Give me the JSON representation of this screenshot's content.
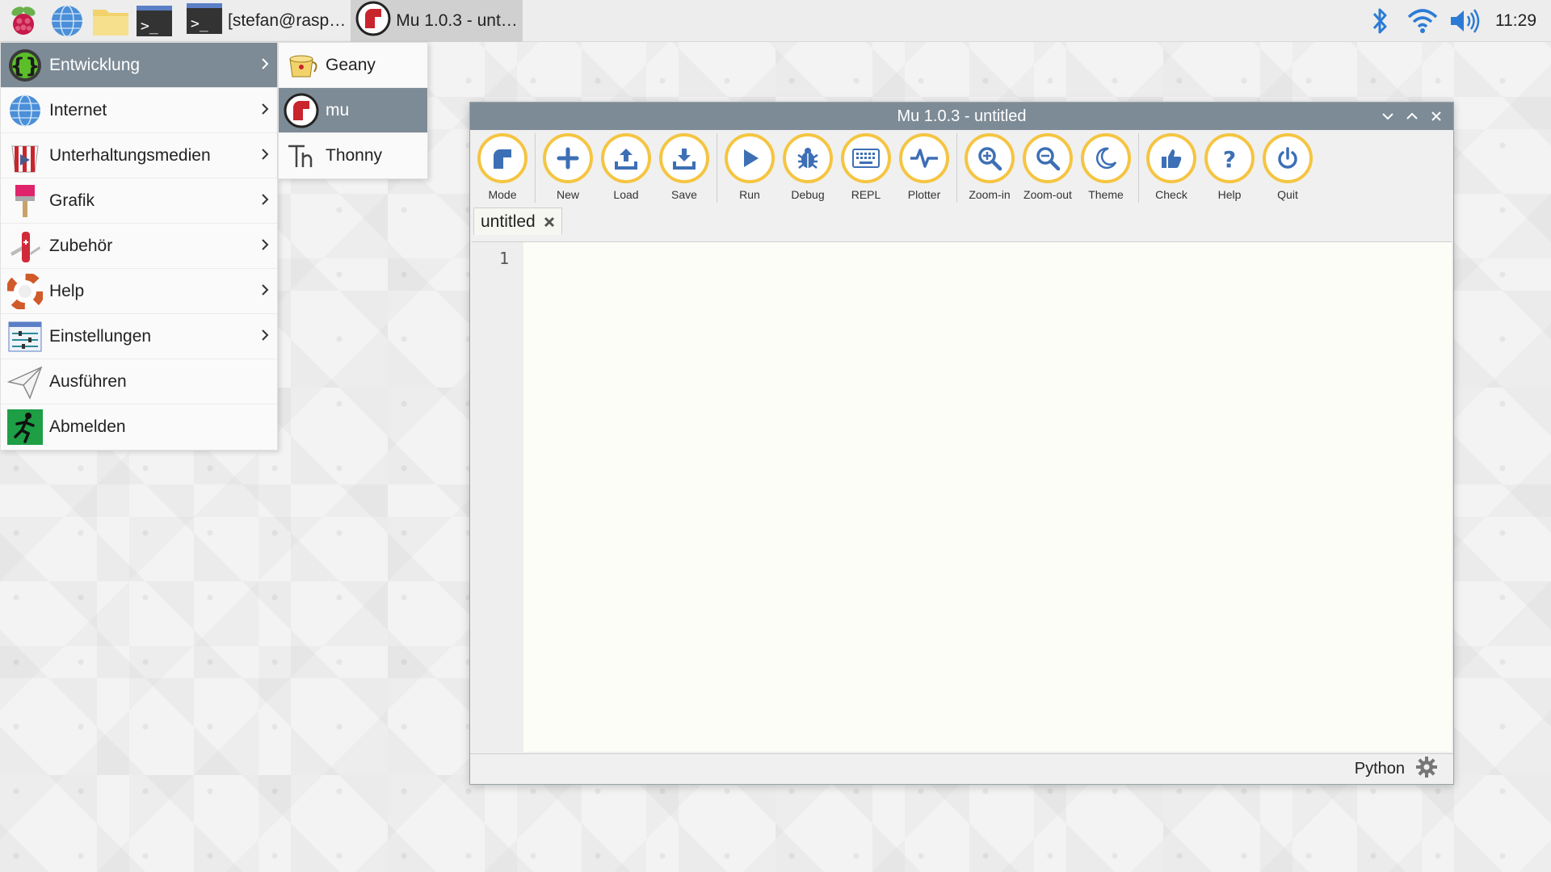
{
  "taskbar": {
    "tasks": [
      {
        "label": "[stefan@rasp…"
      },
      {
        "label": "Mu 1.0.3 - unt…"
      }
    ],
    "clock": "11:29"
  },
  "menu": {
    "items": [
      {
        "label": "Entwicklung",
        "icon": "braces-icon",
        "has_submenu": true
      },
      {
        "label": "Internet",
        "icon": "globe-icon",
        "has_submenu": true
      },
      {
        "label": "Unterhaltungsmedien",
        "icon": "popcorn-icon",
        "has_submenu": true
      },
      {
        "label": "Grafik",
        "icon": "paintbrush-icon",
        "has_submenu": true
      },
      {
        "label": "Zubehör",
        "icon": "knife-icon",
        "has_submenu": true
      },
      {
        "label": "Help",
        "icon": "lifebuoy-icon",
        "has_submenu": true
      },
      {
        "label": "Einstellungen",
        "icon": "sliders-icon",
        "has_submenu": true
      },
      {
        "label": "Ausführen",
        "icon": "paper-plane-icon",
        "has_submenu": false
      },
      {
        "label": "Abmelden",
        "icon": "running-man-icon",
        "has_submenu": false
      }
    ]
  },
  "submenu": {
    "items": [
      {
        "label": "Geany",
        "icon": "geany-icon"
      },
      {
        "label": "mu",
        "icon": "mu-icon"
      },
      {
        "label": "Thonny",
        "icon": "thonny-icon"
      }
    ]
  },
  "mu": {
    "title": "Mu 1.0.3 - untitled",
    "toolbar": {
      "mode": "Mode",
      "new": "New",
      "load": "Load",
      "save": "Save",
      "run": "Run",
      "debug": "Debug",
      "repl": "REPL",
      "plotter": "Plotter",
      "zoom_in": "Zoom-in",
      "zoom_out": "Zoom-out",
      "theme": "Theme",
      "check": "Check",
      "help": "Help",
      "quit": "Quit"
    },
    "tab_label": "untitled",
    "line_number": "1",
    "status_mode": "Python"
  },
  "colors": {
    "highlight": "#7d8b96",
    "button_ring": "#f5c542",
    "accent_blue": "#2b7bd6"
  }
}
